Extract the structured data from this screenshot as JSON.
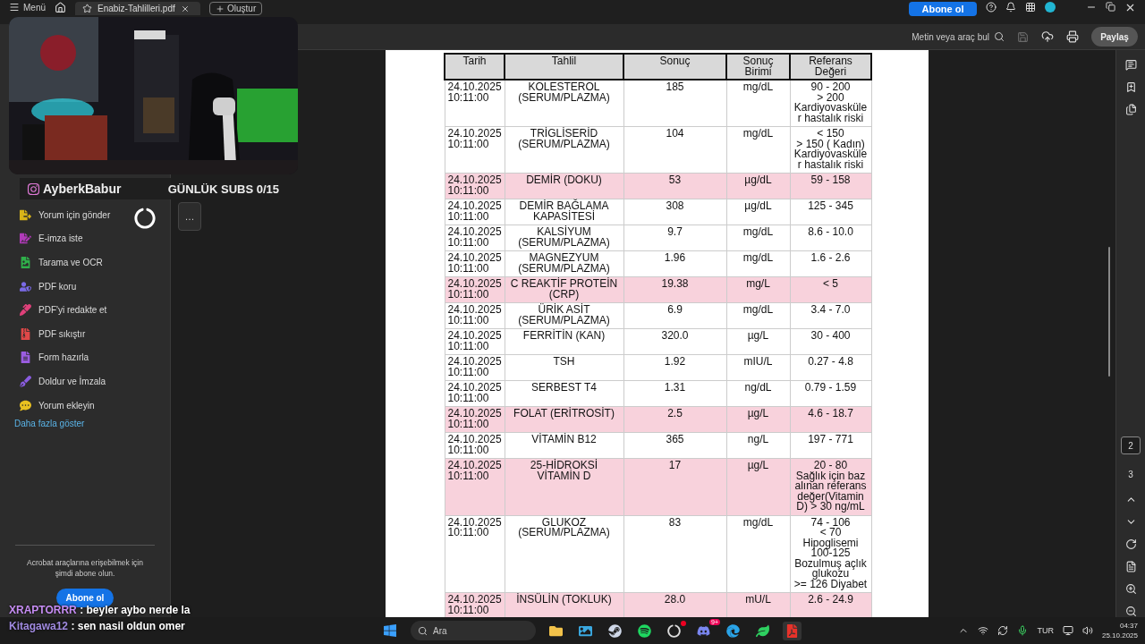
{
  "top_bar": {
    "menu": "Menü",
    "tab_title": "Enabiz-Tahlilleri.pdf",
    "create": "Oluştur",
    "subscribe": "Abone ol"
  },
  "toolbar": {
    "search": "Metin veya araç bul",
    "save": {
      "disabled": true
    },
    "share": "Paylaş"
  },
  "webcam": {
    "kind": "picture",
    "handle": "AyberkBabur",
    "goal": "GÜNLÜK SUBS 0/15"
  },
  "sidebar": {
    "tools": [
      {
        "label": "Yorum için gönder",
        "color": "#d8b418"
      },
      {
        "label": "E-imza iste",
        "color": "#b03ab8"
      },
      {
        "label": "Tarama ve OCR",
        "color": "#2fb04a"
      },
      {
        "label": "PDF koru",
        "color": "#7a6ae6"
      },
      {
        "label": "PDF'yi redakte et",
        "color": "#e0407a"
      },
      {
        "label": "PDF sıkıştır",
        "color": "#e04848"
      },
      {
        "label": "Form hazırla",
        "color": "#9a5ce0"
      },
      {
        "label": "Doldur ve İmzala",
        "color": "#8a5ce0"
      },
      {
        "label": "Yorum ekleyin",
        "color": "#e8c020"
      }
    ],
    "more": "Daha fazla göster",
    "promo": "Acrobat araçlarına erişebilmek için şimdi abone olun.",
    "subscribe": "Abone ol"
  },
  "table": {
    "columns": [
      "Tarih",
      "Tahlil",
      "Sonuç",
      "Sonuç Birimi",
      "Referans Değeri"
    ],
    "rows": [
      {
        "date": "24.10.2025 10:11:00",
        "test": "KOLESTEROL (SERUM/PLAZMA)",
        "result": "185",
        "unit": "mg/dL",
        "reference": "90 - 200\n> 200\nKardiyovasküle\nr hastalık riski",
        "flagged": false
      },
      {
        "date": "24.10.2025 10:11:00",
        "test": "TRİGLİSERİD (SERUM/PLAZMA)",
        "result": "104",
        "unit": "mg/dL",
        "reference": "< 150\n> 150  ( Kadın)\nKardiyovasküle\nr hastalık riski",
        "flagged": false
      },
      {
        "date": "24.10.2025 10:11:00",
        "test": "DEMİR (DOKU)",
        "result": "53",
        "unit": "µg/dL",
        "reference": "59 - 158",
        "flagged": true
      },
      {
        "date": "24.10.2025 10:11:00",
        "test": "DEMİR BAĞLAMA KAPASİTESİ",
        "result": "308",
        "unit": "µg/dL",
        "reference": "125 - 345",
        "flagged": false
      },
      {
        "date": "24.10.2025 10:11:00",
        "test": "KALSİYUM (SERUM/PLAZMA)",
        "result": "9.7",
        "unit": "mg/dL",
        "reference": "8.6 - 10.0",
        "flagged": false
      },
      {
        "date": "24.10.2025 10:11:00",
        "test": "MAGNEZYUM (SERUM/PLAZMA)",
        "result": "1.96",
        "unit": "mg/dL",
        "reference": "1.6 - 2.6",
        "flagged": false
      },
      {
        "date": "24.10.2025 10:11:00",
        "test": "C REAKTİF PROTEİN (CRP)",
        "result": "19.38",
        "unit": "mg/L",
        "reference": "< 5",
        "flagged": true
      },
      {
        "date": "24.10.2025 10:11:00",
        "test": "ÜRİK ASİT (SERUM/PLAZMA)",
        "result": "6.9",
        "unit": "mg/dL",
        "reference": "3.4 - 7.0",
        "flagged": false
      },
      {
        "date": "24.10.2025 10:11:00",
        "test": "FERRİTİN (KAN)",
        "result": "320.0",
        "unit": "µg/L",
        "reference": "30 - 400",
        "flagged": false
      },
      {
        "date": "24.10.2025 10:11:00",
        "test": "TSH",
        "result": "1.92",
        "unit": "mIU/L",
        "reference": "0.27 - 4.8",
        "flagged": false
      },
      {
        "date": "24.10.2025 10:11:00",
        "test": "SERBEST T4",
        "result": "1.31",
        "unit": "ng/dL",
        "reference": "0.79 - 1.59",
        "flagged": false
      },
      {
        "date": "24.10.2025 10:11:00",
        "test": "FOLAT (ERİTROSİT)",
        "result": "2.5",
        "unit": "µg/L",
        "reference": "4.6 - 18.7",
        "flagged": true
      },
      {
        "date": "24.10.2025 10:11:00",
        "test": "VİTAMİN B12",
        "result": "365",
        "unit": "ng/L",
        "reference": "197 - 771",
        "flagged": false
      },
      {
        "date": "24.10.2025 10:11:00",
        "test": "25-HİDROKSİ VİTAMİN D",
        "result": "17",
        "unit": "µg/L",
        "reference": "20 - 80\nSağlık için baz\nalınan referans\ndeğer(Vitamin\nD) > 30 ng/mL",
        "flagged": true
      },
      {
        "date": "24.10.2025 10:11:00",
        "test": "GLUKOZ (SERUM/PLAZMA)",
        "result": "83",
        "unit": "mg/dL",
        "reference": "74 - 106\n< 70\nHipoglisemi\n100-125\nBozulmuş açlık\nglukozu\n>= 126 Diyabet",
        "flagged": false
      },
      {
        "date": "24.10.2025 10:11:00",
        "test": "İNSÜLİN (TOKLUK)",
        "result": "28.0",
        "unit": "mU/L",
        "reference": "2.6 - 24.9",
        "flagged": true
      }
    ]
  },
  "floating_toolbar": {
    "more": "…"
  },
  "page_rail": {
    "pages": [
      {
        "label": "2",
        "selected": true
      },
      {
        "label": "3",
        "selected": false
      }
    ]
  },
  "chat": [
    {
      "user": "XRAPTORRR",
      "text": ": beyler aybo nerde la",
      "color": "#c58cf2"
    },
    {
      "user": "Kitagawa12",
      "text": ": sen nasil oldun omer",
      "color": "#a08ae0"
    }
  ],
  "taskbar": {
    "search": "Ara",
    "discord_badge": "9+",
    "language": "TUR",
    "time": "04:37",
    "date": "25.10.2025"
  }
}
